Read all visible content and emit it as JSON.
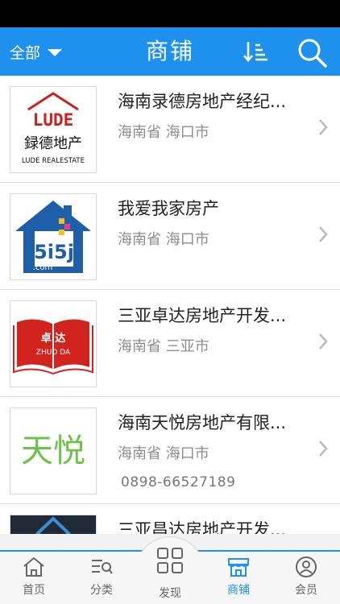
{
  "header": {
    "filter_label": "全部",
    "title": "商铺",
    "sort_icon": "sort-icon",
    "search_icon": "search-icon"
  },
  "shops": [
    {
      "name": "海南录德房地产经纪...",
      "location": "海南省 海口市",
      "phone": "",
      "logo": {
        "top_text": "LUDE",
        "cn_text": "録德地产",
        "en_text": "LUDE REALESTATE"
      }
    },
    {
      "name": "我爱我家房产",
      "location": "海南省 海口市",
      "phone": "",
      "logo": {
        "top_text": "5i5j",
        "cn_text": "",
        "en_text": ".com"
      }
    },
    {
      "name": "三亚卓达房地产开发...",
      "location": "海南省 三亚市",
      "phone": "",
      "logo": {
        "top_text": "卓 达",
        "cn_text": "",
        "en_text": "ZHUO DA"
      }
    },
    {
      "name": "海南天悦房地产有限...",
      "location": "海南省 海口市",
      "phone": "0898-66527189",
      "logo": {
        "top_text": "",
        "cn_text": "天悦",
        "en_text": ""
      }
    },
    {
      "name": "三亚昌达房地产开发...",
      "location": "",
      "phone": "",
      "logo": {
        "top_text": "",
        "cn_text": "",
        "en_text": ""
      }
    }
  ],
  "tabs": [
    {
      "label": "首页",
      "icon": "home-icon"
    },
    {
      "label": "分类",
      "icon": "category-icon"
    },
    {
      "label": "发现",
      "icon": "grid-icon"
    },
    {
      "label": "商铺",
      "icon": "shop-icon"
    },
    {
      "label": "会员",
      "icon": "user-icon"
    }
  ],
  "colors": {
    "accent": "#1e90ee",
    "header_text": "#ffffff",
    "muted_text": "#8d8d8d"
  }
}
